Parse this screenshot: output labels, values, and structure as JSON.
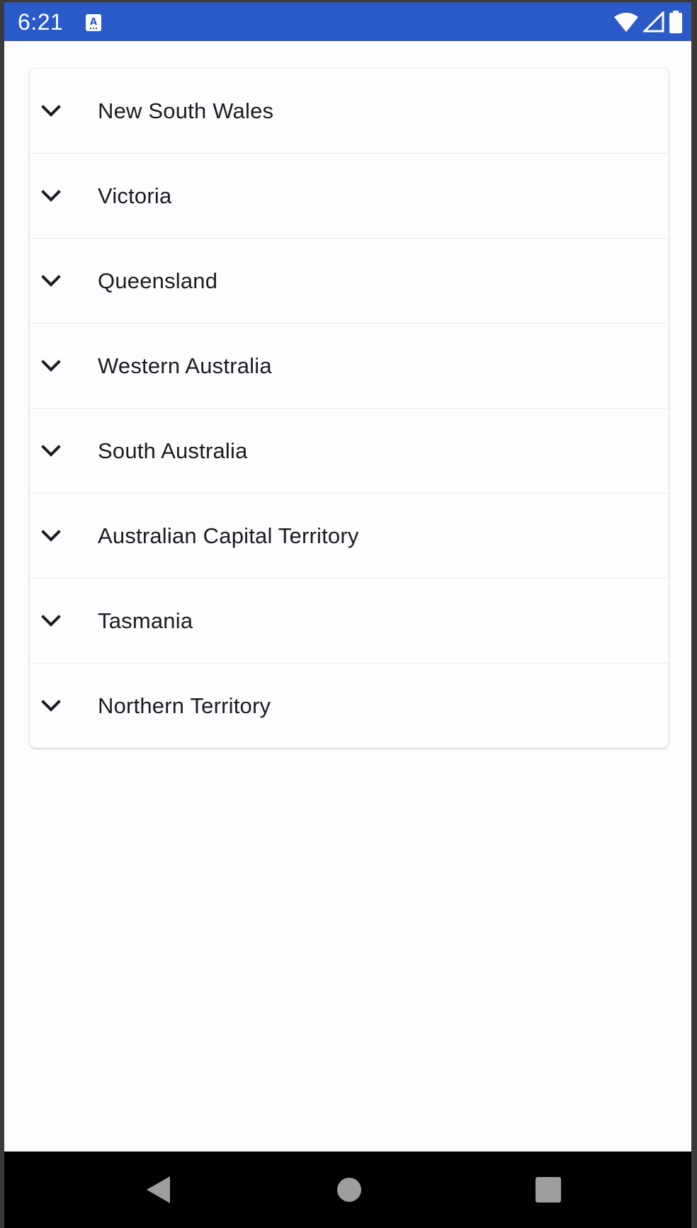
{
  "status_bar": {
    "time": "6:21",
    "background_color": "#2a5ac8",
    "icons": [
      "app-notification-icon",
      "wifi-icon",
      "cell-signal-icon",
      "battery-icon"
    ]
  },
  "states": {
    "items": [
      {
        "label": "New South Wales",
        "icon": "chevron-down-icon"
      },
      {
        "label": "Victoria",
        "icon": "chevron-down-icon"
      },
      {
        "label": "Queensland",
        "icon": "chevron-down-icon"
      },
      {
        "label": "Western Australia",
        "icon": "chevron-down-icon"
      },
      {
        "label": "South Australia",
        "icon": "chevron-down-icon"
      },
      {
        "label": "Australian Capital Territory",
        "icon": "chevron-down-icon"
      },
      {
        "label": "Tasmania",
        "icon": "chevron-down-icon"
      },
      {
        "label": "Northern Territory",
        "icon": "chevron-down-icon"
      }
    ]
  },
  "nav_bar": {
    "buttons": [
      "back-icon",
      "home-icon",
      "recents-icon"
    ]
  }
}
